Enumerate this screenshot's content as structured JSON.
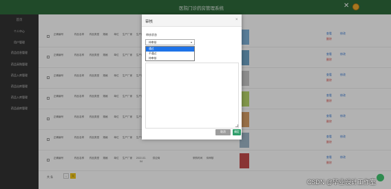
{
  "app": {
    "title": "医院门诊药房管理系统",
    "close_glyph": "✕"
  },
  "sidebar": {
    "header": "首页",
    "items": [
      {
        "label": "个人中心"
      },
      {
        "label": "用户管理"
      },
      {
        "label": "药品信息管理"
      },
      {
        "label": "药品采购管理"
      },
      {
        "label": "药品入库管理"
      },
      {
        "label": "药品出库管理"
      },
      {
        "label": "药品入库管理"
      },
      {
        "label": "药品退库管理"
      }
    ]
  },
  "table": {
    "rows": [
      {
        "values": [
          "正确编号",
          "药品名称",
          "药品类型",
          "规格",
          "单位",
          "生产厂家",
          "生产日期",
          "供应商",
          "采购单价",
          "采购数量",
          "采购时间",
          "审核"
        ],
        "actions": [
          "查看",
          "修改",
          "删除"
        ]
      },
      {
        "values": [
          "正确编号",
          "药品名称",
          "药品类型",
          "规格",
          "单位",
          "生产厂家",
          "生产日期",
          "供应商",
          "采购单价",
          "采购数量",
          "采购时间",
          "审核"
        ],
        "actions": [
          "查看",
          "修改",
          "删除"
        ]
      },
      {
        "values": [
          "正确编号",
          "药品名称",
          "药品类型",
          "规格",
          "单位",
          "生产厂家",
          "生产日期",
          "供应商",
          "采购单价",
          "采购数量",
          "采购时间",
          "审核"
        ],
        "actions": [
          "查看",
          "修改",
          "删除"
        ]
      },
      {
        "values": [
          "正确编号",
          "药品名称",
          "药品类型",
          "规格",
          "单位",
          "生产厂家",
          "生产日期",
          "供应商",
          "采购单价",
          "采购数量",
          "采购时间",
          "审核"
        ],
        "actions": [
          "查看",
          "修改",
          "删除"
        ]
      },
      {
        "values": [
          "正确编号",
          "药品名称",
          "药品类型",
          "规格",
          "单位",
          "生产厂家",
          "生产日期",
          "供应商",
          "采购单价",
          "采购数量",
          "采购时间",
          "审核"
        ],
        "actions": [
          "查看",
          "修改",
          "删除"
        ]
      },
      {
        "values": [
          "正确编号",
          "药品名称",
          "药品类型",
          "规格",
          "单位",
          "生产厂家",
          "生产日期",
          "供应商",
          "采购单价",
          "采购数量",
          "采购时间",
          "审核"
        ],
        "actions": [
          "查看",
          "修改",
          "删除"
        ]
      },
      {
        "values": [
          "正确编号",
          "药品名称",
          "药品类型",
          "规格",
          "单位",
          "生产厂家",
          "2022-02-04",
          "供应商",
          "",
          "",
          "采购时间",
          "待审核"
        ],
        "actions": [
          "查看",
          "修改",
          "删除"
        ]
      }
    ]
  },
  "modal": {
    "title": "审核",
    "close_glyph": "×",
    "field_label": "审核状态",
    "select_value": "待审核",
    "select_arrow": "▾",
    "options": [
      {
        "label": "通过",
        "selected": true
      },
      {
        "label": "不通过",
        "selected": false
      },
      {
        "label": "待审核",
        "selected": false
      }
    ],
    "cancel_label": "取消",
    "ok_label": "确定"
  },
  "pagination": {
    "label": "共 条",
    "current_page": "1"
  },
  "watermark": "CSDN @毕业设计工作室",
  "colors": {
    "topbar": "#2f6b3c",
    "sidebar": "#333333",
    "accent": "#1e73e8",
    "confirm": "#2e9e6a"
  },
  "icons": {
    "close": "close-icon",
    "avatar": "avatar",
    "edit": "edit-icon",
    "delete": "delete-icon",
    "view": "view-icon"
  }
}
